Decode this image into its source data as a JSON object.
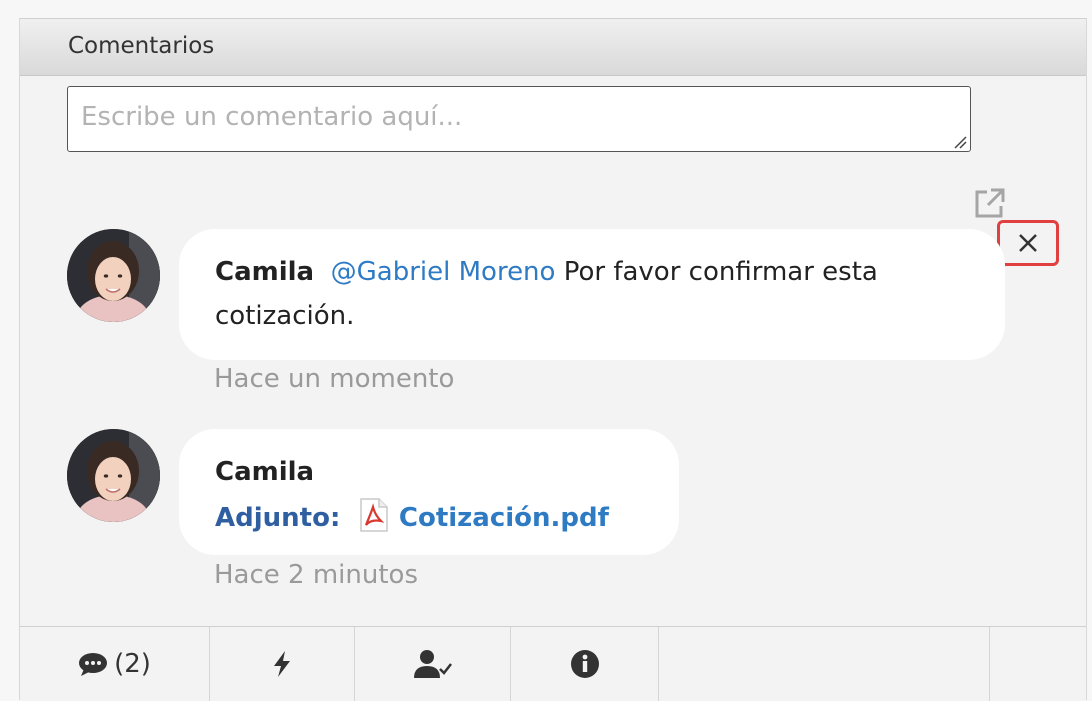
{
  "panel": {
    "title": "Comentarios"
  },
  "comment_box": {
    "placeholder": "Escribe un comentario aquí...",
    "value": ""
  },
  "comments": [
    {
      "author": "Camila",
      "mention": "@Gabriel Moreno",
      "text_line1": "Por favor confirmar esta",
      "text_line2": "cotización.",
      "time": "Hace un momento"
    },
    {
      "author": "Camila",
      "attachment_label": "Adjunto:",
      "attachment_name": "Cotización.pdf",
      "time": "Hace 2 minutos"
    }
  ],
  "footer": {
    "comments_count": "(2)",
    "tabs": [
      "comments-icon",
      "lightning-icon",
      "user-check-icon",
      "info-icon"
    ]
  },
  "colors": {
    "mention": "#2e7bc4",
    "attachment_label": "#2f5fa0",
    "close_highlight": "#e04040",
    "pdf": "#d9382e"
  }
}
